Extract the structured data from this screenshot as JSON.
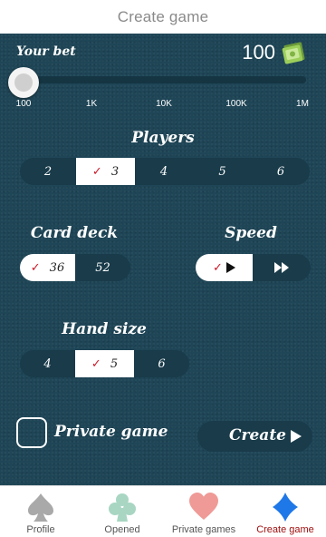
{
  "header": {
    "title": "Create game"
  },
  "bet": {
    "label": "Your bet",
    "amount": "100",
    "slider_level": 0,
    "ticks": [
      "100",
      "1K",
      "10K",
      "100K",
      "1M"
    ]
  },
  "players": {
    "title": "Players",
    "options": [
      "2",
      "3",
      "4",
      "5",
      "6"
    ],
    "selected": "3"
  },
  "card_deck": {
    "title": "Card deck",
    "options": [
      "36",
      "52"
    ],
    "selected": "36"
  },
  "speed": {
    "title": "Speed",
    "options": [
      "play-icon",
      "fast-forward-icon"
    ],
    "selected": "play-icon"
  },
  "hand_size": {
    "title": "Hand size",
    "options": [
      "4",
      "5",
      "6"
    ],
    "selected": "5"
  },
  "private_game": {
    "label": "Private game",
    "checked": false
  },
  "create_button": {
    "label": "Create"
  },
  "nav": [
    {
      "label": "Profile",
      "icon": "spade-icon",
      "color": "#a9a9a9"
    },
    {
      "label": "Opened",
      "icon": "club-icon",
      "color": "#a8d6c3"
    },
    {
      "label": "Private games",
      "icon": "heart-icon",
      "color": "#ef9a96"
    },
    {
      "label": "Create game",
      "icon": "diamond-icon",
      "color": "#1f78e8",
      "active": true
    }
  ],
  "colors": {
    "felt": "#1f4657",
    "checkmark": "#cc1a2a",
    "active_nav": "#a01010"
  }
}
